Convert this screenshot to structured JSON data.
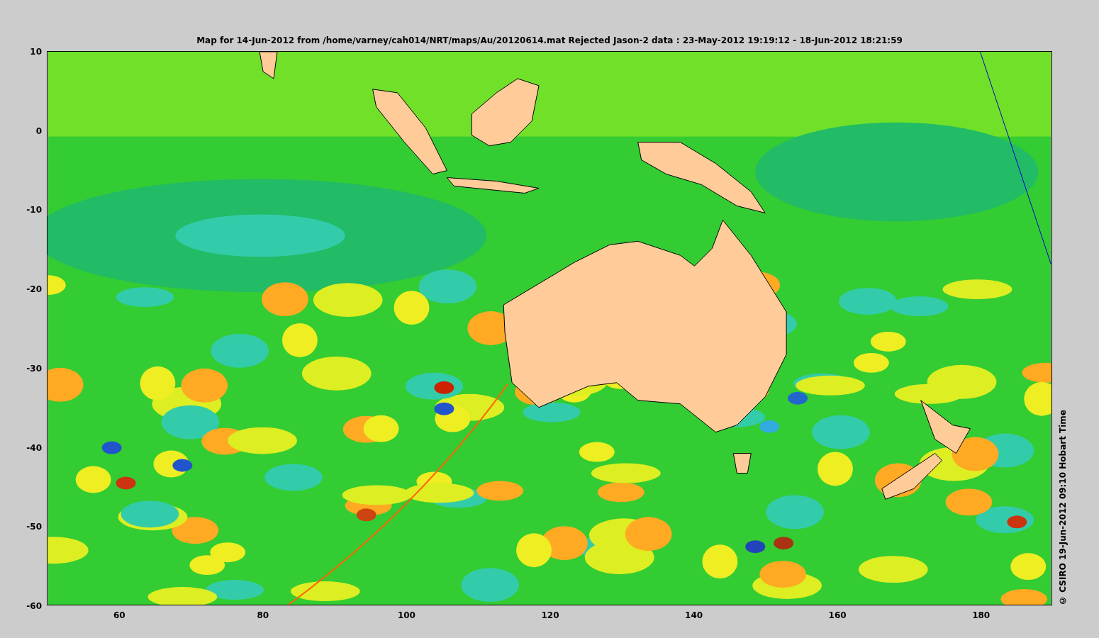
{
  "title": "Map for 14-Jun-2012 from /home/varney/cah014/NRT/maps/Au/20120614.mat  Rejected Jason-2 data : 23-May-2012 19:19:12 - 18-Jun-2012 18:21:59",
  "axes": {
    "xticks": [
      "60",
      "80",
      "100",
      "120",
      "140",
      "160",
      "180"
    ],
    "yticks": [
      "10",
      "0",
      "-10",
      "-20",
      "-30",
      "-40",
      "-50",
      "-60"
    ]
  },
  "credit": "© CSIRO 19-Jun-2012 09:10 Hobart Time"
}
